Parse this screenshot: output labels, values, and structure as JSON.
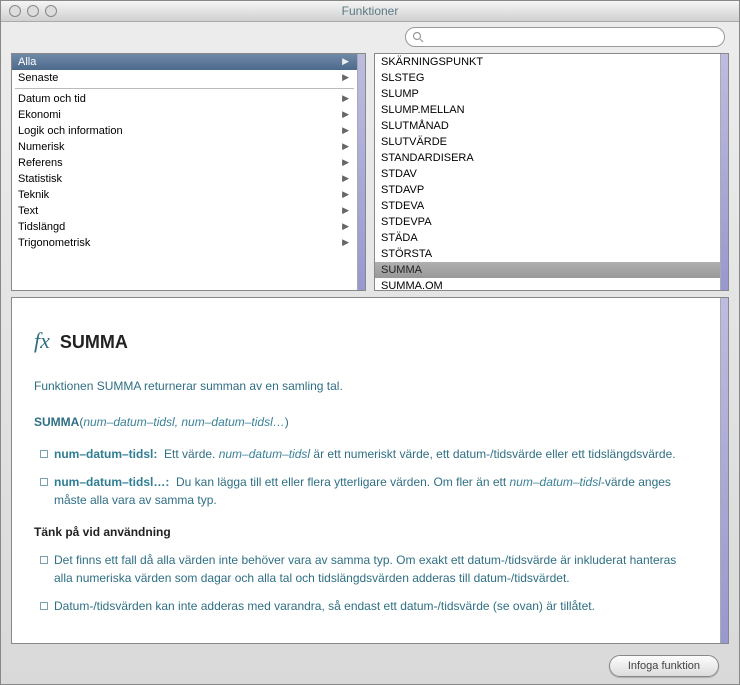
{
  "window": {
    "title": "Funktioner"
  },
  "search": {
    "value": "",
    "placeholder": ""
  },
  "categories": {
    "top": [
      {
        "label": "Alla",
        "selected": true
      },
      {
        "label": "Senaste",
        "selected": false
      }
    ],
    "groups": [
      {
        "label": "Datum och tid"
      },
      {
        "label": "Ekonomi"
      },
      {
        "label": "Logik och information"
      },
      {
        "label": "Numerisk"
      },
      {
        "label": "Referens"
      },
      {
        "label": "Statistisk"
      },
      {
        "label": "Teknik"
      },
      {
        "label": "Text"
      },
      {
        "label": "Tidslängd"
      },
      {
        "label": "Trigonometrisk"
      }
    ]
  },
  "functions": [
    {
      "label": "SKÄRNINGSPUNKT"
    },
    {
      "label": "SLSTEG"
    },
    {
      "label": "SLUMP"
    },
    {
      "label": "SLUMP.MELLAN"
    },
    {
      "label": "SLUTMÅNAD"
    },
    {
      "label": "SLUTVÄRDE"
    },
    {
      "label": "STANDARDISERA"
    },
    {
      "label": "STDAV"
    },
    {
      "label": "STDAVP"
    },
    {
      "label": "STDEVA"
    },
    {
      "label": "STDEVPA"
    },
    {
      "label": "STÄDA"
    },
    {
      "label": "STÖRSTA"
    },
    {
      "label": "SUMMA",
      "selected": true
    },
    {
      "label": "SUMMA.OM"
    }
  ],
  "description": {
    "fx": "fx",
    "name": "SUMMA",
    "summary": "Funktionen SUMMA returnerar summan av en samling tal.",
    "syntax_name": "SUMMA",
    "syntax_args": "num–datum–tidsl, num–datum–tidsl…",
    "params": [
      {
        "name": "num–datum–tidsl:",
        "text_before": "Ett värde. ",
        "ital": "num–datum–tidsl",
        "text_after": " är ett numeriskt värde, ett datum-/tidsvärde eller ett tidslängdsvärde."
      },
      {
        "name": "num–datum–tidsl…:",
        "text_before": "Du kan lägga till ett eller flera ytterligare värden. Om fler än ett ",
        "ital": "num–datum–tidsl",
        "text_after": "-värde anges måste alla vara av samma typ."
      }
    ],
    "notes_header": "Tänk på vid användning",
    "notes": [
      "Det finns ett fall då alla värden inte behöver vara av samma typ. Om exakt ett datum-/tidsvärde är inkluderat hanteras alla numeriska värden som dagar och alla tal och tidslängdsvärden adderas till datum-/tidsvärdet.",
      "Datum-/tidsvärden kan inte adderas med varandra, så endast ett datum-/tidsvärde (se ovan) är tillåtet."
    ]
  },
  "buttons": {
    "insert": "Infoga funktion"
  }
}
